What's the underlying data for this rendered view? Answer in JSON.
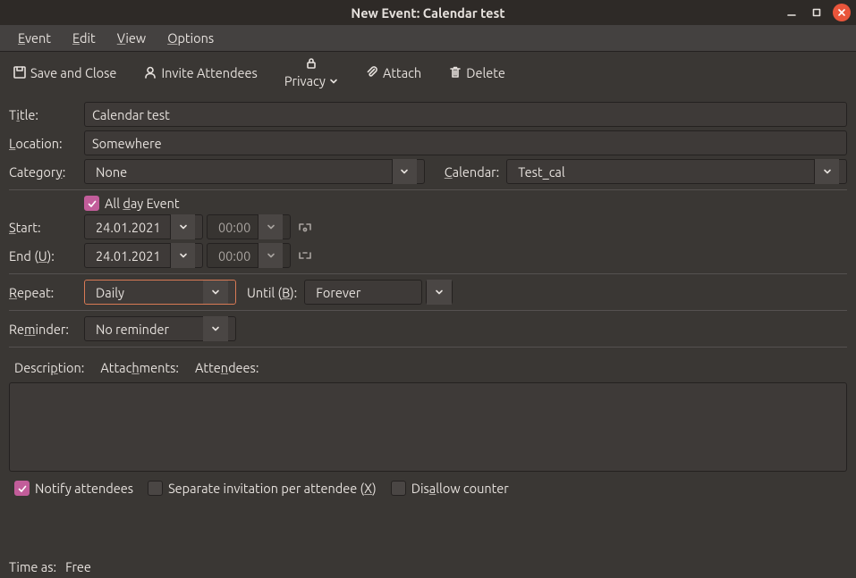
{
  "window": {
    "title": "New Event: Calendar test"
  },
  "menubar": {
    "event": "Event",
    "edit": "Edit",
    "view": "View",
    "options": "Options"
  },
  "toolbar": {
    "save_close": "Save and Close",
    "invite": "Invite Attendees",
    "privacy": "Privacy",
    "attach": "Attach",
    "delete": "Delete"
  },
  "labels": {
    "title": "Title:",
    "location": "Location:",
    "category": "Category:",
    "calendar": "Calendar:",
    "allday": "All day Event",
    "start": "Start:",
    "end": "End (U):",
    "repeat": "Repeat:",
    "until": "Until (B):",
    "reminder": "Reminder:",
    "description": "Description:",
    "attachments": "Attachments:",
    "attendees": "Attendees:"
  },
  "fields": {
    "title": "Calendar test",
    "location": "Somewhere",
    "category": "None",
    "calendar": "Test_cal",
    "allday_checked": true,
    "start_date": "24.01.2021",
    "start_time": "00:00",
    "end_date": "24.01.2021",
    "end_time": "00:00",
    "repeat": "Daily",
    "until": "Forever",
    "reminder": "No reminder"
  },
  "options": {
    "notify": {
      "label": "Notify attendees",
      "checked": true
    },
    "separate": {
      "label": "Separate invitation per attendee (X)",
      "checked": false
    },
    "disallow": {
      "label": "Disallow counter",
      "checked": false
    }
  },
  "status": {
    "label": "Time as:",
    "value": "Free"
  }
}
